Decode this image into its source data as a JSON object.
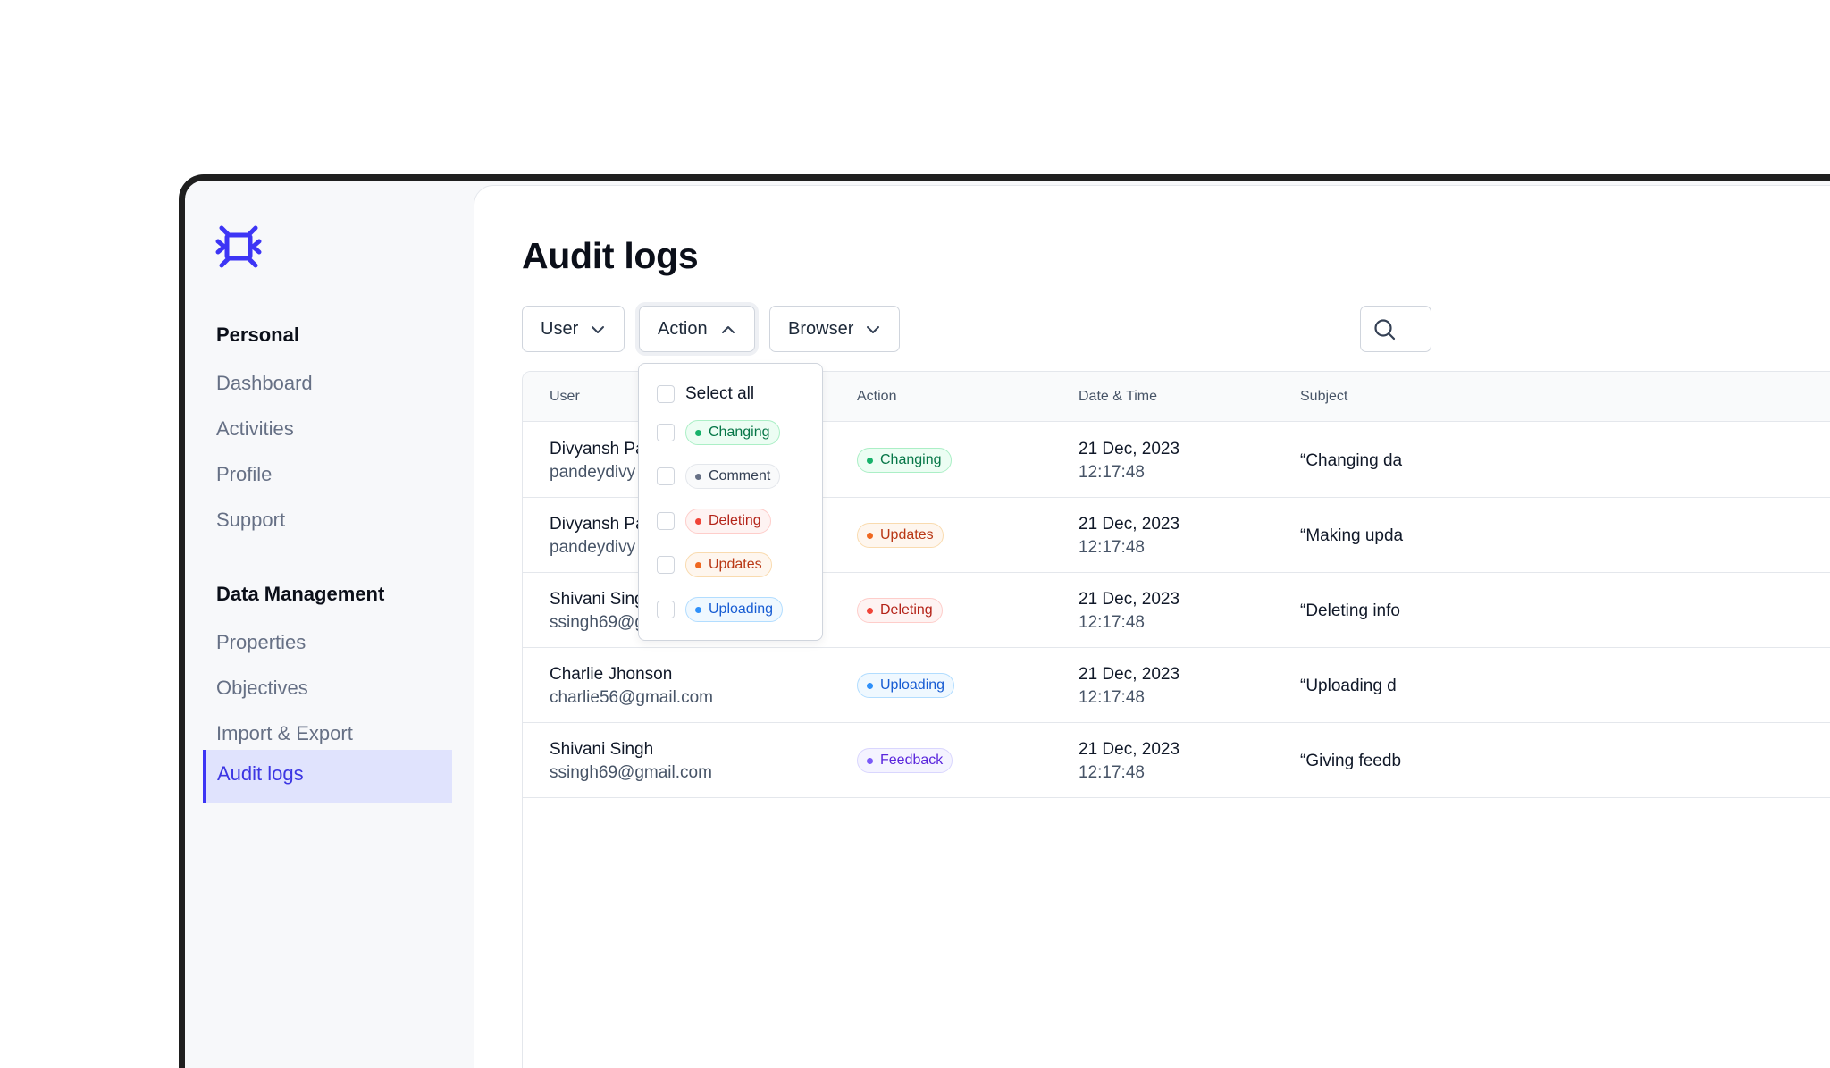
{
  "sidebar": {
    "logo_icon": "logo-mark",
    "sections": [
      {
        "title": "Personal",
        "items": [
          "Dashboard",
          "Activities",
          "Profile",
          "Support"
        ]
      },
      {
        "title": "Data Management",
        "items": [
          "Properties",
          "Objectives",
          "Import & Export",
          "Audit logs"
        ]
      }
    ],
    "active_item": "Audit logs"
  },
  "main": {
    "title": "Audit logs",
    "filters": [
      {
        "label": "User",
        "state": "collapsed"
      },
      {
        "label": "Action",
        "state": "expanded"
      },
      {
        "label": "Browser",
        "state": "collapsed"
      }
    ],
    "search_icon": "search-icon"
  },
  "action_dropdown": {
    "select_all": "Select all",
    "options": [
      {
        "label": "Changing",
        "color": "green"
      },
      {
        "label": "Comment",
        "color": "gray"
      },
      {
        "label": "Deleting",
        "color": "red"
      },
      {
        "label": "Updates",
        "color": "orange"
      },
      {
        "label": "Uploading",
        "color": "blue"
      }
    ]
  },
  "table": {
    "headers": [
      "User",
      "Action",
      "Date & Time",
      "Subject"
    ],
    "rows": [
      {
        "name": "Divyansh Pa",
        "email": "pandeydivy",
        "action": "Changing",
        "date": "21 Dec, 2023",
        "time": "12:17:48",
        "subject": "“Changing da"
      },
      {
        "name": "Divyansh Pa",
        "email": "pandeydivy",
        "action": "Updates",
        "date": "21 Dec, 2023",
        "time": "12:17:48",
        "subject": "“Making upda"
      },
      {
        "name": "Shivani Sing",
        "email": "ssingh69@g",
        "action": "Deleting",
        "date": "21 Dec, 2023",
        "time": "12:17:48",
        "subject": "“Deleting info"
      },
      {
        "name": "Charlie Jhonson",
        "email": "charlie56@gmail.com",
        "action": "Uploading",
        "date": "21 Dec, 2023",
        "time": "12:17:48",
        "subject": "“Uploading d"
      },
      {
        "name": "Shivani Singh",
        "email": "ssingh69@gmail.com",
        "action": "Feedback",
        "date": "21 Dec, 2023",
        "time": "12:17:48",
        "subject": "“Giving feedb"
      }
    ]
  },
  "colors": {
    "accent": "#3d35f5",
    "active_nav_bg": "#e0e3fd"
  }
}
